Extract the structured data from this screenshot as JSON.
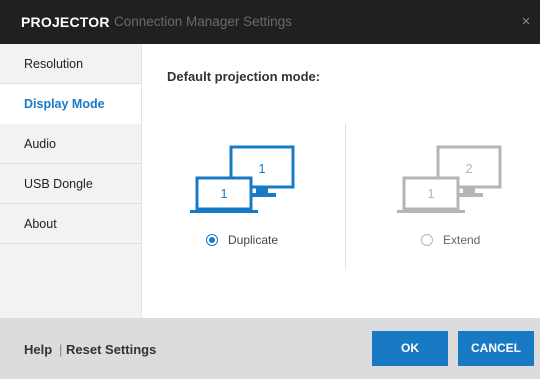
{
  "window": {
    "title_strong": "PROJECTOR",
    "title_sub": "Connection Manager Settings",
    "close_glyph": "×"
  },
  "sidebar": {
    "items": [
      {
        "label": "Resolution",
        "active": false
      },
      {
        "label": "Display Mode",
        "active": true
      },
      {
        "label": "Audio",
        "active": false
      },
      {
        "label": "USB Dongle",
        "active": false
      },
      {
        "label": "About",
        "active": false
      }
    ]
  },
  "main": {
    "heading": "Default projection mode:",
    "options": [
      {
        "label": "Duplicate",
        "selected": true,
        "front_number": "1",
        "back_number": "1",
        "icon": "duplicate-displays-icon"
      },
      {
        "label": "Extend",
        "selected": false,
        "front_number": "1",
        "back_number": "2",
        "icon": "extend-displays-icon"
      }
    ]
  },
  "footer": {
    "help": "Help",
    "separator": "|",
    "reset": "Reset Settings",
    "ok": "OK",
    "cancel": "CANCEL"
  },
  "colors": {
    "accent": "#1879c5",
    "titlebar": "#202020",
    "inactive_icon": "#b5b5b5",
    "sidebar_bg": "#f2f2f2",
    "footer_bg": "#dcdcdc"
  }
}
